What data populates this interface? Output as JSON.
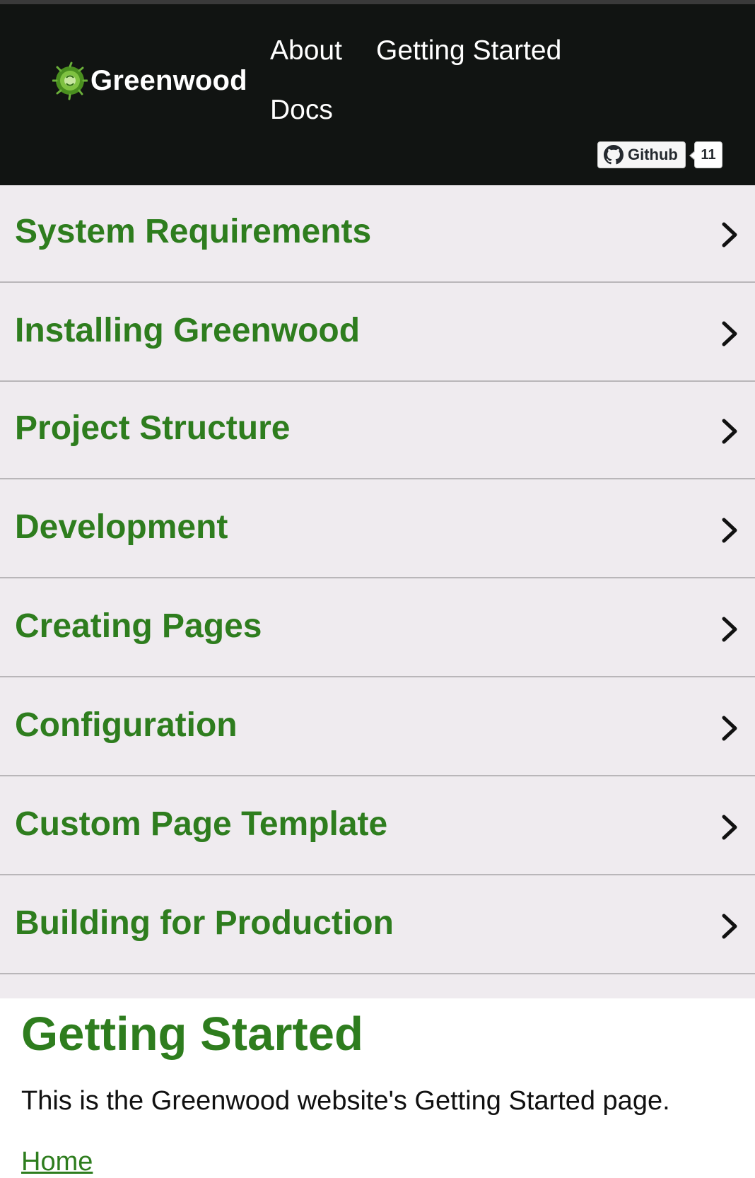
{
  "header": {
    "brand_name": "Greenwood",
    "logo_icon": "greenwood-logo-icon",
    "nav": {
      "about": "About",
      "getting_started": "Getting Started",
      "docs": "Docs"
    },
    "github_button": {
      "icon": "github-icon",
      "label": "Github",
      "count": "11"
    },
    "colors": {
      "background": "#111412",
      "text": "#ffffff"
    }
  },
  "sidebar": {
    "chevron_icon": "chevron-right-icon",
    "items": [
      {
        "label": "System Requirements"
      },
      {
        "label": "Installing Greenwood"
      },
      {
        "label": "Project Structure"
      },
      {
        "label": "Development"
      },
      {
        "label": "Creating Pages"
      },
      {
        "label": "Configuration"
      },
      {
        "label": "Custom Page Template"
      },
      {
        "label": "Building for Production"
      }
    ],
    "colors": {
      "background": "#efebef",
      "label": "#2e7d1e"
    }
  },
  "main": {
    "title": "Getting Started",
    "intro": "This is the Greenwood website's Getting Started page.",
    "home_link": "Home"
  }
}
